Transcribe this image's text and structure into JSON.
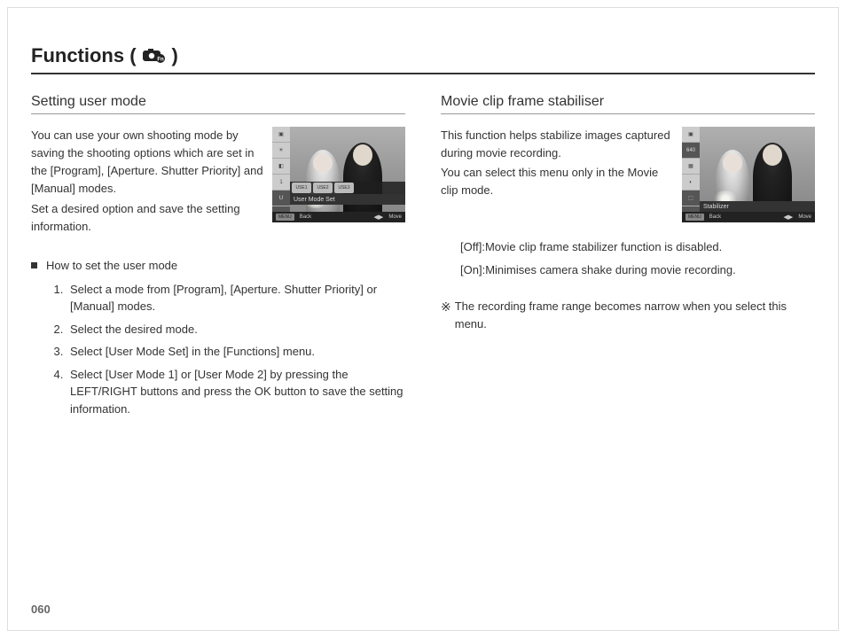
{
  "page": {
    "title_prefix": "Functions (",
    "title_suffix": ")",
    "number": "060"
  },
  "left": {
    "heading": "Setting user mode",
    "intro1": "You can use your own shooting mode by saving the shooting options which are set in the [Program], [Aperture. Shutter Priority] and [Manual] modes.",
    "intro2": "Set a desired option and save the setting information.",
    "screen": {
      "userrow": {
        "u1": "USE1",
        "u2": "USE2",
        "u3": "USE3"
      },
      "label": "User Mode Set",
      "bottom": {
        "menu": "MENU",
        "back": "Back",
        "move": "Move"
      }
    },
    "howto_title": "How to set the user mode",
    "steps": [
      "Select a mode from [Program], [Aperture. Shutter Priority] or [Manual] modes.",
      "Select the desired mode.",
      "Select [User Mode Set] in the [Functions] menu.",
      "Select [User Mode 1] or [User Mode 2] by pressing the LEFT/RIGHT buttons and press the OK button to save the setting information."
    ]
  },
  "right": {
    "heading": "Movie clip frame stabiliser",
    "intro1": "This function helps stabilize images captured during movie recording.",
    "intro2": "You can select this menu only in the Movie clip mode.",
    "screen": {
      "side_640": "640",
      "label": "Stabilizer",
      "bottom": {
        "menu": "MENU",
        "back": "Back",
        "move": "Move"
      }
    },
    "options": [
      {
        "key": "[Off]: ",
        "desc": "Movie clip frame stabilizer function is disabled."
      },
      {
        "key": "[On]: ",
        "desc": "Minimises camera shake during movie recording."
      }
    ],
    "note_mark": "※",
    "note": "The recording frame range becomes narrow when you select this menu."
  }
}
